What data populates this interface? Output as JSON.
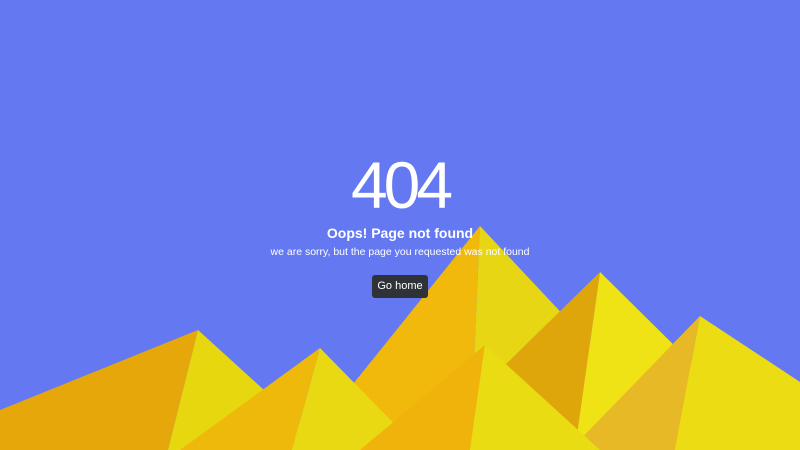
{
  "page": {
    "error_code": "404",
    "title": "Oops! Page not found",
    "message": "we are sorry, but the page you requested was not found",
    "home_button_label": "Go home"
  },
  "colors": {
    "background": "#6479f1",
    "button_bg": "#2f3236",
    "text": "#ffffff",
    "mountain_light": "#eadc12",
    "mountain_mid": "#f0c10f",
    "mountain_dark": "#e2a60a"
  }
}
